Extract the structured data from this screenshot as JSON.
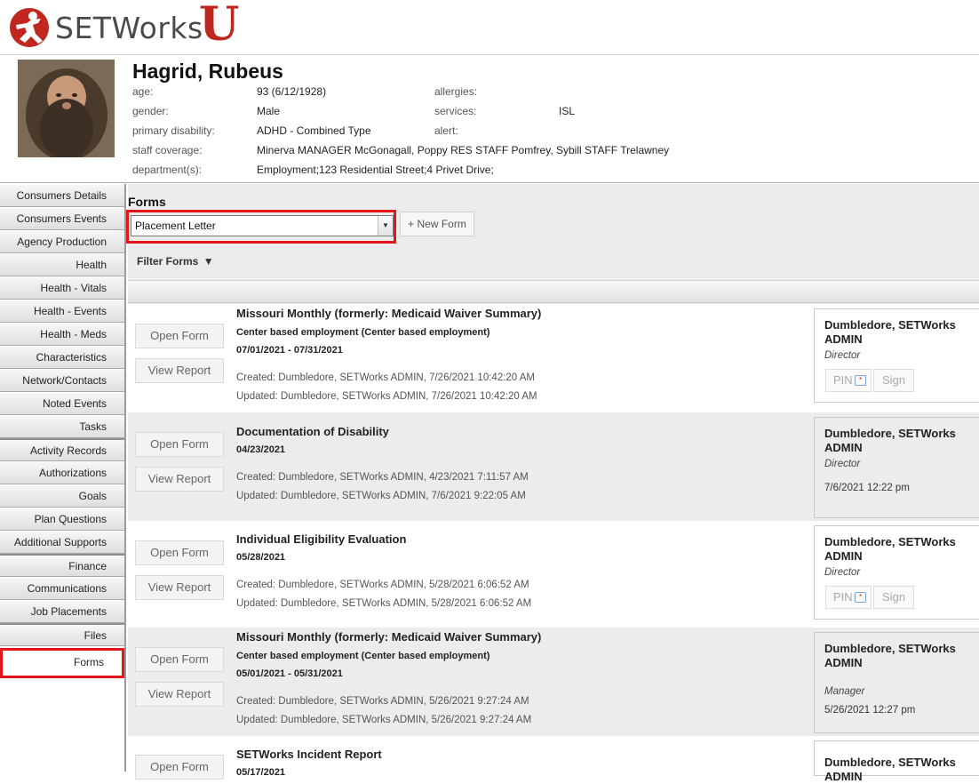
{
  "app": {
    "logo_text": "SETWorks",
    "logo_suffix": "U"
  },
  "consumer": {
    "name": "Hagrid, Rubeus",
    "labels": {
      "age": "age:",
      "gender": "gender:",
      "primary_disability": "primary disability:",
      "staff_coverage": "staff coverage:",
      "departments": "department(s):",
      "allergies": "allergies:",
      "services": "services:",
      "alert": "alert:"
    },
    "age": "93 (6/12/1928)",
    "gender": "Male",
    "primary_disability": "ADHD - Combined Type",
    "staff_coverage": "Minerva MANAGER McGonagall, Poppy RES STAFF Pomfrey, Sybill STAFF Trelawney",
    "departments": "Employment;123 Residential Street;4 Privet Drive;",
    "allergies": "",
    "services": "ISL",
    "alert": ""
  },
  "sidebar": {
    "items": [
      {
        "label": "Consumers Details"
      },
      {
        "label": "Consumers Events"
      },
      {
        "label": "Agency Production"
      },
      {
        "label": "Health"
      },
      {
        "label": "Health - Vitals"
      },
      {
        "label": "Health - Events"
      },
      {
        "label": "Health - Meds"
      },
      {
        "label": "Characteristics"
      },
      {
        "label": "Network/Contacts"
      },
      {
        "label": "Noted Events"
      },
      {
        "label": "Tasks"
      },
      {
        "label": "Activity Records"
      },
      {
        "label": "Authorizations"
      },
      {
        "label": "Goals"
      },
      {
        "label": "Plan Questions"
      },
      {
        "label": "Additional Supports"
      },
      {
        "label": "Finance"
      },
      {
        "label": "Communications"
      },
      {
        "label": "Job Placements"
      },
      {
        "label": "Files"
      },
      {
        "label": "Forms"
      }
    ]
  },
  "forms": {
    "title": "Forms",
    "select_value": "Placement Letter",
    "new_form_label": "+ New Form",
    "filter_label": "Filter Forms",
    "open_label": "Open Form",
    "view_label": "View Report",
    "pin_label": "PIN",
    "sign_label": "Sign",
    "rows": [
      {
        "title": "Missouri Monthly (formerly: Medicaid Waiver Summary)",
        "subtitle": "Center based employment (Center based employment)",
        "dates": "07/01/2021 - 07/31/2021",
        "created": "Created: Dumbledore, SETWorks ADMIN, 7/26/2021 10:42:20 AM",
        "updated": "Updated: Dumbledore, SETWorks ADMIN, 7/26/2021 10:42:20 AM",
        "signer": "Dumbledore, SETWorks ADMIN",
        "role": "Director",
        "sig_date": ""
      },
      {
        "title": "Documentation of Disability",
        "subtitle": "",
        "dates": "04/23/2021",
        "created": "Created: Dumbledore, SETWorks ADMIN, 4/23/2021 7:11:57 AM",
        "updated": "Updated: Dumbledore, SETWorks ADMIN, 7/6/2021 9:22:05 AM",
        "signer": "Dumbledore, SETWorks ADMIN",
        "role": "Director",
        "sig_date": "7/6/2021 12:22 pm"
      },
      {
        "title": "Individual Eligibility Evaluation",
        "subtitle": "",
        "dates": "05/28/2021",
        "created": "Created: Dumbledore, SETWorks ADMIN, 5/28/2021 6:06:52 AM",
        "updated": "Updated: Dumbledore, SETWorks ADMIN, 5/28/2021 6:06:52 AM",
        "signer": "Dumbledore, SETWorks ADMIN",
        "role": "Director",
        "sig_date": ""
      },
      {
        "title": "Missouri Monthly (formerly: Medicaid Waiver Summary)",
        "subtitle": "Center based employment (Center based employment)",
        "dates": "05/01/2021 - 05/31/2021",
        "created": "Created: Dumbledore, SETWorks ADMIN, 5/26/2021 9:27:24 AM",
        "updated": "Updated: Dumbledore, SETWorks ADMIN, 5/26/2021 9:27:24 AM",
        "signer": "Dumbledore, SETWorks ADMIN",
        "role": "Manager",
        "sig_date": "5/26/2021 12:27 pm"
      },
      {
        "title": "SETWorks Incident Report",
        "subtitle": "",
        "dates": "05/17/2021",
        "created": "",
        "updated": "",
        "signer": "Dumbledore, SETWorks ADMIN",
        "role": "",
        "sig_date": ""
      }
    ]
  },
  "colors": {
    "brand_red": "#c0271e",
    "highlight": "#e4141b"
  }
}
